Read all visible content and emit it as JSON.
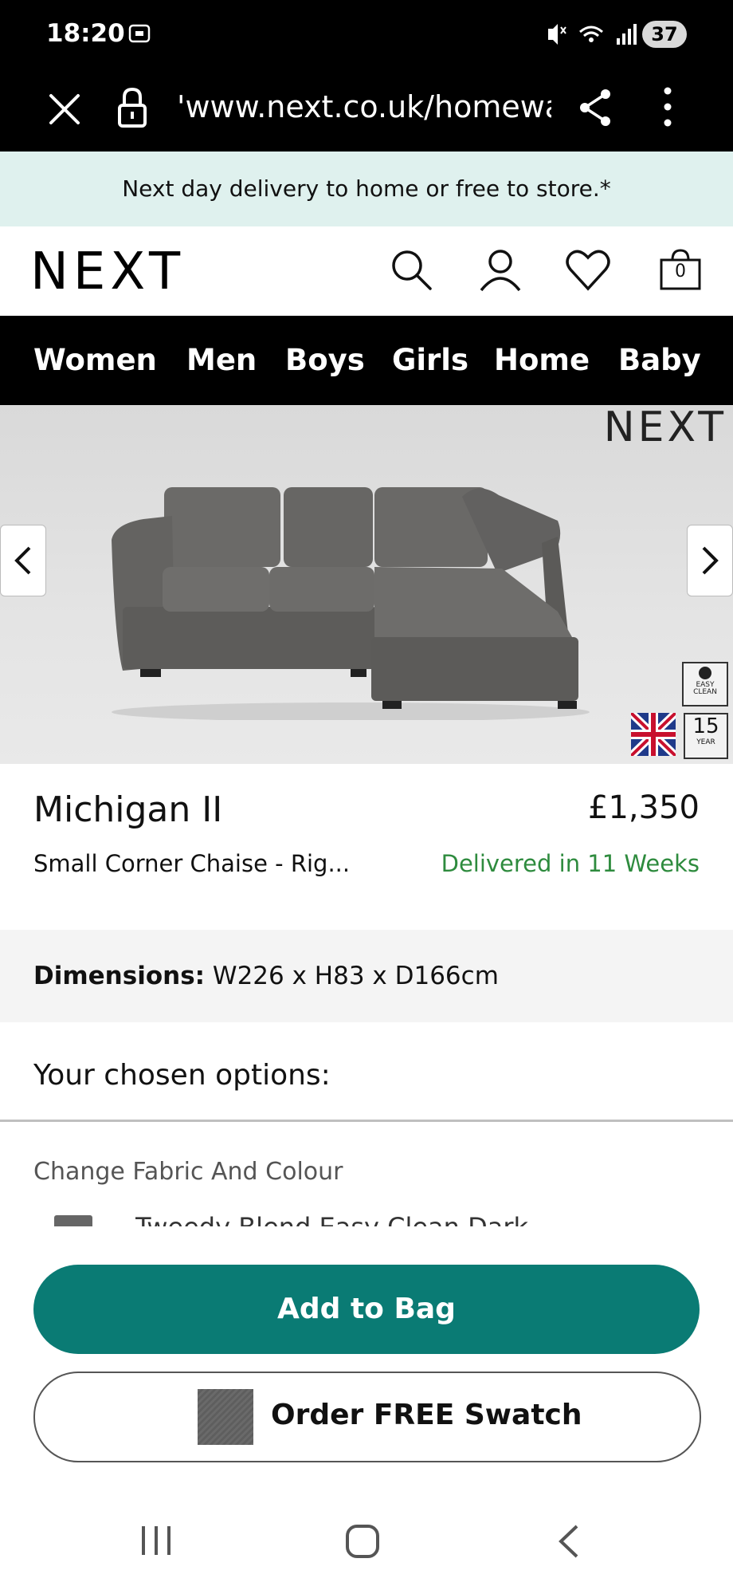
{
  "status_bar": {
    "time": "18:20",
    "battery": "37"
  },
  "browser": {
    "url": "'www.next.co.uk/homewa"
  },
  "promo": {
    "text": "Next day delivery to home or free to store.*"
  },
  "header": {
    "logo": "NEXT",
    "basket_count": "0"
  },
  "nav": {
    "items": [
      "Women",
      "Men",
      "Boys",
      "Girls",
      "Home",
      "Baby"
    ]
  },
  "gallery": {
    "brand_text": "NEXT",
    "badge_easy_clean": "EASY CLEAN",
    "badge_years": "15",
    "badge_year_label": "YEAR"
  },
  "product": {
    "name": "Michigan II",
    "price": "£1,350",
    "subtitle": "Small Corner Chaise - Rig...",
    "delivery": "Delivered in 11 Weeks",
    "dimensions_label": "Dimensions:",
    "dimensions_value": "W226 x H83 x D166cm"
  },
  "options": {
    "heading": "Your chosen options:",
    "fabric_label": "Change Fabric And Colour",
    "fabric_name": "Tweedy Blend Easy Clean Dark"
  },
  "actions": {
    "add_to_bag": "Add to Bag",
    "order_swatch": "Order FREE Swatch"
  },
  "colors": {
    "accent": "#0a7b74",
    "delivery_green": "#2e8b3e",
    "promo_bg": "#dff1ee"
  }
}
